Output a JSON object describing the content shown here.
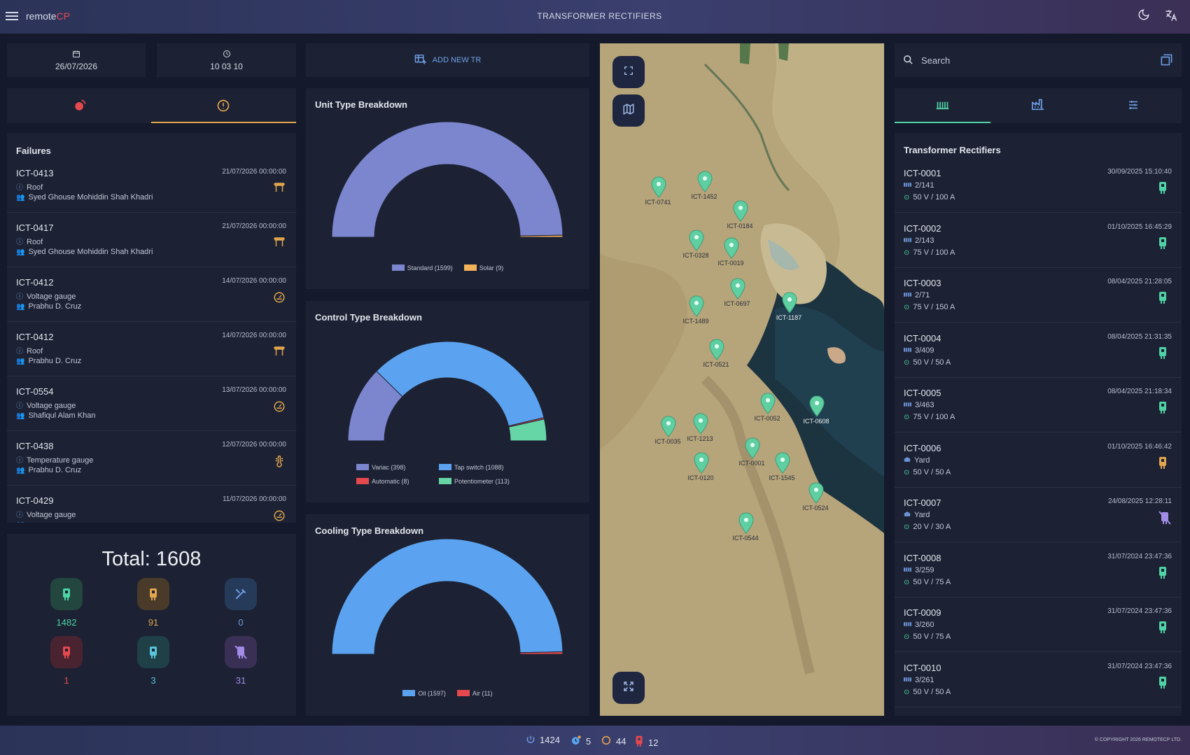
{
  "app": {
    "brand_prefix": "remote",
    "brand_suffix": "CP",
    "title": "TRANSFORMER RECTIFIERS",
    "theme_icon": "moon-icon",
    "translate_icon": "translate-icon",
    "menu_icon": "hamburger-icon"
  },
  "header_left": {
    "date": "26/07/2026",
    "time": "10 03 10"
  },
  "left_tabs": [
    {
      "icon": "alarm-icon",
      "active": false
    },
    {
      "icon": "warning-icon",
      "active": true
    }
  ],
  "failures": {
    "title": "Failures",
    "items": [
      {
        "id": "ICT-0413",
        "date": "21/07/2026 00:00:00",
        "type": "Roof",
        "person": "Syed Ghouse Mohiddin Shah Khadri",
        "icon": "roof-icon"
      },
      {
        "id": "ICT-0417",
        "date": "21/07/2026 00:00:00",
        "type": "Roof",
        "person": "Syed Ghouse Mohiddin Shah Khadri",
        "icon": "roof-icon"
      },
      {
        "id": "ICT-0412",
        "date": "14/07/2026 00:00:00",
        "type": "Voltage gauge",
        "person": "Prabhu D. Cruz",
        "icon": "gauge-icon"
      },
      {
        "id": "ICT-0412",
        "date": "14/07/2026 00:00:00",
        "type": "Roof",
        "person": "Prabhu D. Cruz",
        "icon": "roof-icon"
      },
      {
        "id": "ICT-0554",
        "date": "13/07/2026 00:00:00",
        "type": "Voltage gauge",
        "person": "Shafiqul Alam Khan",
        "icon": "gauge-icon"
      },
      {
        "id": "ICT-0438",
        "date": "12/07/2026 00:00:00",
        "type": "Temperature gauge",
        "person": "Prabhu D. Cruz",
        "icon": "thermometer-icon"
      },
      {
        "id": "ICT-0429",
        "date": "11/07/2026 00:00:00",
        "type": "Voltage gauge",
        "person": "",
        "icon": "gauge-icon"
      }
    ]
  },
  "summary": {
    "total_label": "Total: 1608",
    "stats": [
      {
        "value": "1482",
        "color": "#4fd2a4",
        "bg": "#23463f",
        "icon": "tr-ok-icon"
      },
      {
        "value": "91",
        "color": "#e2a54e",
        "bg": "#4a3a2a",
        "icon": "tr-warn-icon"
      },
      {
        "value": "0",
        "color": "#6ea0ea",
        "bg": "#263a5a",
        "icon": "tools-icon"
      },
      {
        "value": "1",
        "color": "#e5484d",
        "bg": "#4a2330",
        "icon": "tr-fail-icon"
      },
      {
        "value": "3",
        "color": "#5ac4d8",
        "bg": "#204048",
        "icon": "tr-info-icon"
      },
      {
        "value": "31",
        "color": "#a38be8",
        "bg": "#3a2f55",
        "icon": "tr-off-icon"
      }
    ]
  },
  "add_tr_label": "ADD NEW TR",
  "charts": [
    {
      "title": "Unit Type Breakdown",
      "type": "pie",
      "segments": [
        {
          "label": "Standard (1599)",
          "value": 1599,
          "color": "#7c86cf"
        },
        {
          "label": "Solar (9)",
          "value": 9,
          "color": "#f3b35a"
        }
      ]
    },
    {
      "title": "Control Type Breakdown",
      "type": "pie",
      "segments": [
        {
          "label": "Variac (398)",
          "value": 398,
          "color": "#7c86cf"
        },
        {
          "label": "Tap switch (1088)",
          "value": 1088,
          "color": "#5ba3f0"
        },
        {
          "label": "Automatic (8)",
          "value": 8,
          "color": "#e5484d"
        },
        {
          "label": "Potentiometer (113)",
          "value": 113,
          "color": "#67d6a6"
        }
      ]
    },
    {
      "title": "Cooling Type Breakdown",
      "type": "pie",
      "segments": [
        {
          "label": "Oil (1597)",
          "value": 1597,
          "color": "#5ba3f0"
        },
        {
          "label": "Air (11)",
          "value": 11,
          "color": "#e5484d"
        }
      ]
    }
  ],
  "map": {
    "buttons": [
      "fullscreen-icon",
      "map-layers-icon",
      "collapse-icon"
    ],
    "pins": [
      "ICT-0741",
      "ICT-1452",
      "ICT-0184",
      "ICT-0328",
      "ICT-0019",
      "ICT-0697",
      "ICT-1187",
      "ICT-1489",
      "ICT-0521",
      "ICT-0052",
      "ICT-0608",
      "ICT-0035",
      "ICT-1213",
      "ICT-0001",
      "ICT-1545",
      "ICT-0120",
      "ICT-0524",
      "ICT-0544"
    ]
  },
  "search": {
    "placeholder": "Search",
    "icon": "search-icon",
    "action_icon": "copy-icon"
  },
  "right_tabs": [
    {
      "icon": "list-bars-icon",
      "active": true
    },
    {
      "icon": "factory-icon",
      "active": false
    },
    {
      "icon": "filter-sliders-icon",
      "active": false
    }
  ],
  "rectifiers": {
    "title": "Transformer Rectifiers",
    "items": [
      {
        "id": "ICT-0001",
        "date": "30/09/2025 15:10:40",
        "loc": "2/141",
        "rating": "50 V / 100 A",
        "status": "#4fd2a4",
        "loc_icon": "rack-icon"
      },
      {
        "id": "ICT-0002",
        "date": "01/10/2025 16:45:29",
        "loc": "2/143",
        "rating": "75 V / 100 A",
        "status": "#4fd2a4",
        "loc_icon": "rack-icon"
      },
      {
        "id": "ICT-0003",
        "date": "08/04/2025 21:28:05",
        "loc": "2/71",
        "rating": "75 V / 150 A",
        "status": "#4fd2a4",
        "loc_icon": "rack-icon"
      },
      {
        "id": "ICT-0004",
        "date": "08/04/2025 21:31:35",
        "loc": "3/409",
        "rating": "50 V / 50 A",
        "status": "#4fd2a4",
        "loc_icon": "rack-icon"
      },
      {
        "id": "ICT-0005",
        "date": "08/04/2025 21:18:34",
        "loc": "3/463",
        "rating": "75 V / 100 A",
        "status": "#4fd2a4",
        "loc_icon": "rack-icon"
      },
      {
        "id": "ICT-0006",
        "date": "01/10/2025 16:46:42",
        "loc": "Yard",
        "rating": "50 V / 50 A",
        "status": "#e2a54e",
        "loc_icon": "yard-icon"
      },
      {
        "id": "ICT-0007",
        "date": "24/08/2025 12:28:11",
        "loc": "Yard",
        "rating": "20 V / 30 A",
        "status": "#a38be8",
        "loc_icon": "yard-icon"
      },
      {
        "id": "ICT-0008",
        "date": "31/07/2024 23:47:36",
        "loc": "3/259",
        "rating": "50 V / 75 A",
        "status": "#4fd2a4",
        "loc_icon": "rack-icon"
      },
      {
        "id": "ICT-0009",
        "date": "31/07/2024 23:47:36",
        "loc": "3/260",
        "rating": "50 V / 75 A",
        "status": "#4fd2a4",
        "loc_icon": "rack-icon"
      },
      {
        "id": "ICT-0010",
        "date": "31/07/2024 23:47:36",
        "loc": "3/261",
        "rating": "50 V / 50 A",
        "status": "#4fd2a4",
        "loc_icon": "rack-icon"
      }
    ]
  },
  "footer": {
    "stats": [
      {
        "value": "1424",
        "icon": "power-icon"
      },
      {
        "value": "5",
        "icon": "clock-alert-icon"
      },
      {
        "value": "44",
        "icon": "circle-icon"
      },
      {
        "value": "12",
        "icon": "tr-fail-icon"
      }
    ],
    "copyright": "© COPYRIGHT 2026 REMOTECP LTD."
  }
}
